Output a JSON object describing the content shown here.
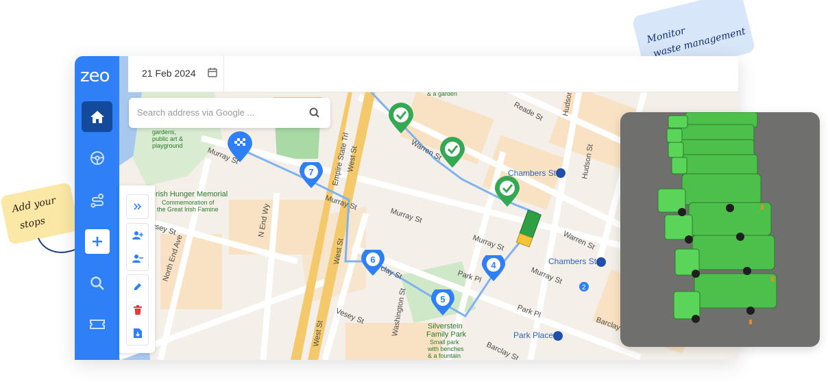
{
  "brand": {
    "logo": "zeo",
    "accent": "#2f80f6",
    "dark_accent": "#134a9c"
  },
  "topbar": {
    "date": "21 Feb 2024",
    "calendar_icon": "calendar-icon"
  },
  "search": {
    "placeholder": "Search address via Google ...",
    "icon": "search-icon"
  },
  "sidebar": {
    "items": [
      {
        "name": "home",
        "icon": "home-icon"
      },
      {
        "name": "drive",
        "icon": "steering-wheel-icon"
      },
      {
        "name": "routes",
        "icon": "route-icon"
      },
      {
        "name": "add",
        "icon": "plus-icon"
      },
      {
        "name": "search",
        "icon": "search-icon"
      },
      {
        "name": "tickets",
        "icon": "ticket-icon"
      }
    ]
  },
  "toolbar": {
    "items": [
      "expand-icon",
      "add-user-icon",
      "remove-user-icon",
      "edit-icon",
      "delete-icon",
      "download-icon"
    ]
  },
  "map": {
    "streets": [
      "Murray St",
      "Murray St",
      "Murray St",
      "Murray St",
      "Warren St",
      "Warren St",
      "Reade St",
      "Reade St",
      "West St",
      "West St",
      "West St",
      "Barclay St",
      "Barclay St",
      "Park Pl",
      "Park Pl",
      "Vesey St",
      "Vesey St",
      "Hudson St",
      "Hudson St",
      "Washington St",
      "N End Ave",
      "North End Ave",
      "N End Wy",
      "Empire State Trl",
      "Chambers St"
    ],
    "places": {
      "memorial": [
        "Irish Hunger Memorial",
        "Commemoration of",
        "the Great Irish Famine"
      ],
      "gardens": [
        "gardens,",
        "public art &",
        "playground"
      ],
      "park": [
        "Silverstein",
        "Family Park",
        "Small park",
        "with benches",
        "& a fountain"
      ],
      "garden_top": "& a garden",
      "station1": "Chambers St",
      "station2": "Chambers St",
      "station3": "Park Place"
    },
    "stops": [
      {
        "label": "7",
        "type": "numbered"
      },
      {
        "label": "6",
        "type": "numbered"
      },
      {
        "label": "5",
        "type": "numbered"
      },
      {
        "label": "4",
        "type": "numbered"
      }
    ],
    "completed_stops": 3,
    "badge": "2"
  },
  "callouts": {
    "left": [
      "Add your",
      "stops"
    ],
    "right": [
      "Monitor",
      "waste management"
    ]
  }
}
